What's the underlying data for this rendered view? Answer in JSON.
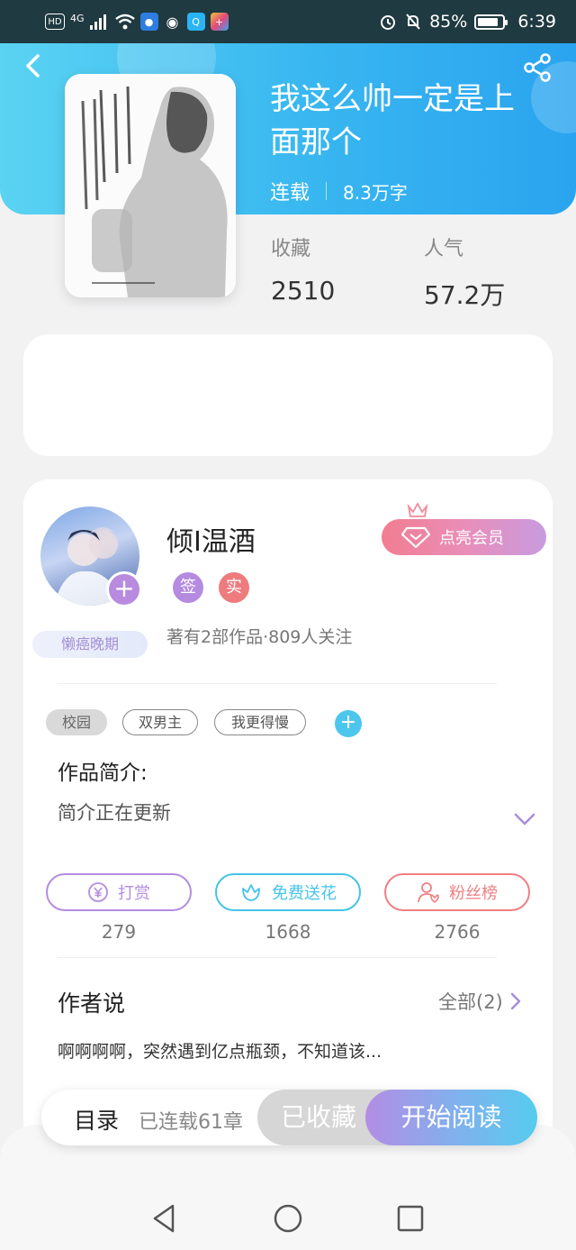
{
  "status_bar": {
    "network": "HD",
    "signal": "4G",
    "battery_percent": "85%",
    "battery_level": 0.85,
    "time": "6:39"
  },
  "header": {
    "back_icon": "chevron-left-icon",
    "share_icon": "share-icon",
    "cover_image": "book-cover-illustration"
  },
  "book": {
    "title": "我这么帅一定是上面那个",
    "status": "连载",
    "word_count": "8.3万字"
  },
  "stats": {
    "favorites_label": "收藏",
    "favorites_value": "2510",
    "popularity_label": "人气",
    "popularity_value": "57.2万"
  },
  "author": {
    "name": "倾I温酒",
    "tags": [
      "签",
      "实"
    ],
    "badge": "懒癌晚期",
    "works": "著有2部作品·809人关注",
    "vip_button": "点亮会员"
  },
  "book_tags": [
    "校园",
    "双男主",
    "我更得慢"
  ],
  "intro": {
    "title": "作品简介:",
    "text": "简介正在更新"
  },
  "actions": [
    {
      "label": "打赏",
      "count": "279",
      "icon": "yen-coin-icon",
      "color": "#b38de0"
    },
    {
      "label": "免费送花",
      "count": "1668",
      "icon": "flower-icon",
      "color": "#46c3e8"
    },
    {
      "label": "粉丝榜",
      "count": "2766",
      "icon": "fan-rank-icon",
      "color": "#ef7f84"
    }
  ],
  "author_says": {
    "title": "作者说",
    "see_all": "全部(2)",
    "excerpt": "啊啊啊啊，突然遇到亿点瓶颈，不知道该..."
  },
  "bottom_bar": {
    "toc": "目录",
    "chapters": "已连载61章",
    "collected": "已收藏",
    "read": "开始阅读"
  },
  "colors": {
    "header_gradient_start": "#5ad3f2",
    "header_gradient_end": "#2aa4ef",
    "accent_purple": "#b88bdf",
    "accent_blue": "#4dc6ee",
    "accent_red": "#ef7f84"
  }
}
